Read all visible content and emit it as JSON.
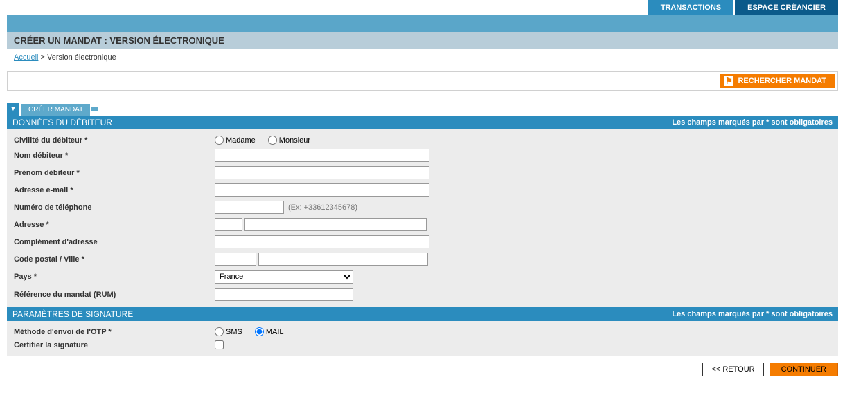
{
  "nav": {
    "transactions": "TRANSACTIONS",
    "espace_creancier": "ESPACE CRÉANCIER"
  },
  "page_title": "CRÉER UN MANDAT : VERSION ÉLECTRONIQUE",
  "breadcrumb": {
    "home": "Accueil",
    "sep": " > ",
    "current": "Version électronique"
  },
  "search_btn": "RECHERCHER MANDAT",
  "tab": {
    "label": "CRÉER MANDAT"
  },
  "section_debtor": {
    "title": "DONNÉES DU DÉBITEUR",
    "required_note": "Les champs marqués par * sont obligatoires"
  },
  "fields": {
    "civilite": {
      "label": "Civilité du débiteur *",
      "opt_madame": "Madame",
      "opt_monsieur": "Monsieur"
    },
    "nom": {
      "label": "Nom débiteur *"
    },
    "prenom": {
      "label": "Prénom débiteur *"
    },
    "email": {
      "label": "Adresse e-mail *"
    },
    "tel": {
      "label": "Numéro de téléphone",
      "hint": "(Ex: +33612345678)"
    },
    "adresse": {
      "label": "Adresse *"
    },
    "complement": {
      "label": "Complément d'adresse"
    },
    "cp_ville": {
      "label": "Code postal / Ville *"
    },
    "pays": {
      "label": "Pays *",
      "selected": "France"
    },
    "rum": {
      "label": "Référence du mandat (RUM)"
    }
  },
  "section_sign": {
    "title": "PARAMÈTRES DE SIGNATURE",
    "required_note": "Les champs marqués par * sont obligatoires"
  },
  "sign_fields": {
    "otp": {
      "label": "Méthode d'envoi de l'OTP *",
      "opt_sms": "SMS",
      "opt_mail": "MAIL"
    },
    "certifier": {
      "label": "Certifier la signature"
    }
  },
  "buttons": {
    "retour": "<< RETOUR",
    "continuer": "CONTINUER"
  }
}
